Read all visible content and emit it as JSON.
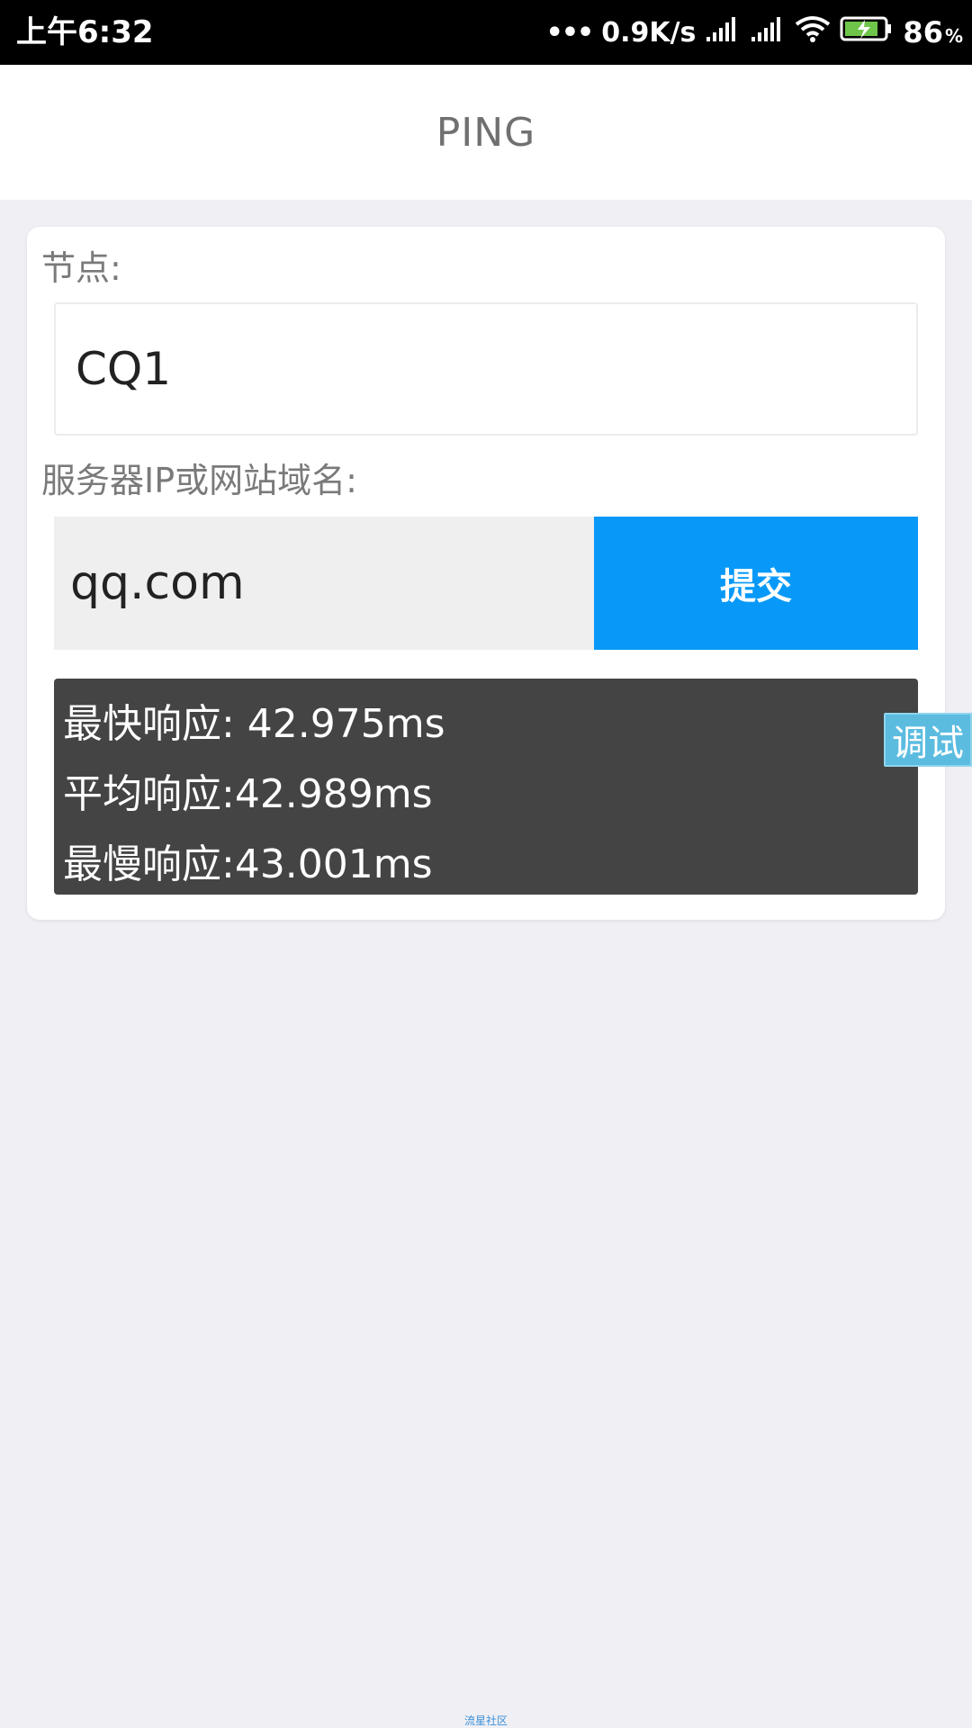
{
  "status_bar": {
    "time": "上午6:32",
    "network_speed": "0.9K/s",
    "battery_percent": "86",
    "battery_unit": "%"
  },
  "header": {
    "title": "PING"
  },
  "form": {
    "node_label": "节点:",
    "node_value": "CQ1",
    "server_label": "服务器IP或网站域名:",
    "server_value": "qq.com",
    "submit_label": "提交"
  },
  "results": {
    "fastest": "最快响应: 42.975ms",
    "average": "平均响应:42.989ms",
    "slowest": "最慢响应:43.001ms"
  },
  "debug_tab": {
    "label": "调试"
  },
  "footer": {
    "text": "流星社区"
  },
  "colors": {
    "accent": "#0899f8",
    "results_bg": "#444444",
    "page_bg": "#efeff4",
    "debug_tab": "#5bbce0"
  },
  "icons": [
    "more-dots-icon",
    "signal-icon",
    "signal-icon-2",
    "wifi-icon",
    "battery-charging-icon"
  ]
}
